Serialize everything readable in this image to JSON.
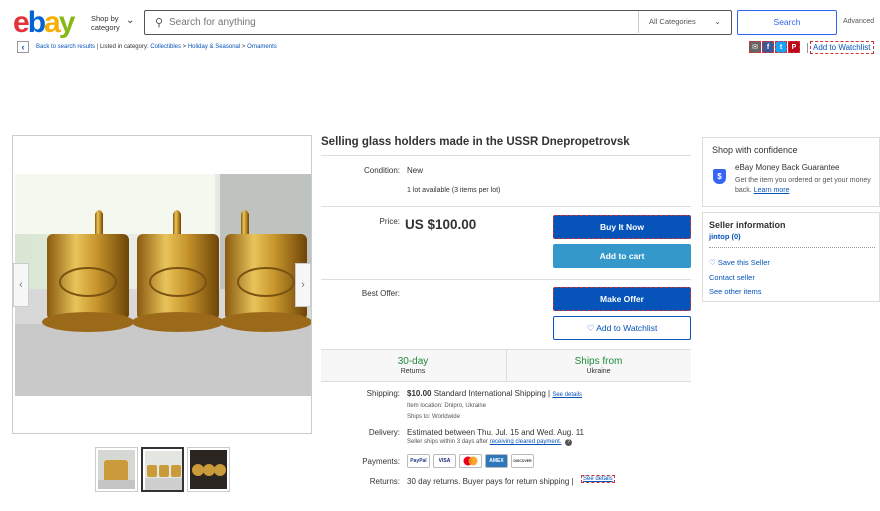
{
  "header": {
    "logo": {
      "e": "e",
      "b": "b",
      "a": "a",
      "y": "y"
    },
    "shop_by_category": "Shop by category",
    "search_placeholder": "Search for anything",
    "category_select": "All Categories",
    "search_button": "Search",
    "advanced": "Advanced"
  },
  "breadcrumb": {
    "back": "Back to search results",
    "listed_in": "Listed in category:",
    "items": [
      "Collectibles",
      "Holiday & Seasonal",
      "Ornaments"
    ]
  },
  "top_watchlist": "Add to Watchlist",
  "listing": {
    "title": "Selling glass holders made in the USSR Dnepropetrovsk",
    "condition_label": "Condition:",
    "condition_value": "New",
    "availability": "1 lot available (3 items per lot)",
    "price_label": "Price:",
    "price": "US $100.00",
    "buy_it_now": "Buy It Now",
    "add_to_cart": "Add to cart",
    "best_offer_label": "Best Offer:",
    "make_offer": "Make Offer",
    "add_to_watchlist": "Add to Watchlist",
    "returns_big": "30-day",
    "returns_sub": "Returns",
    "ships_from_big": "Ships from",
    "ships_from_sub": "Ukraine",
    "shipping_label": "Shipping:",
    "shipping_price": "$10.00",
    "shipping_method": "Standard International Shipping |",
    "see_details": "See details",
    "item_location": "Item location: Dnipro, Ukraine",
    "ships_to": "Ships to: Worldwide",
    "delivery_label": "Delivery:",
    "delivery_estimate": "Estimated between Thu. Jul. 15 and Wed. Aug. 11",
    "delivery_note": "Seller ships within 3 days after",
    "delivery_link": "receiving cleared payment.",
    "payments_label": "Payments:",
    "payment_methods": [
      "PayPal",
      "VISA",
      "MC",
      "AMEX",
      "DISCOVER"
    ],
    "returns_label": "Returns:",
    "returns_text": "30 day returns. Buyer pays for return shipping |",
    "returns_see_details": "See details"
  },
  "confidence": {
    "heading": "Shop with confidence",
    "guarantee": "eBay Money Back Guarantee",
    "guarantee_desc": "Get the item you ordered or get your money back.",
    "learn_more": "Learn more"
  },
  "seller": {
    "heading": "Seller information",
    "name": "jintop (0)",
    "save": "Save this Seller",
    "contact": "Contact seller",
    "other_items": "See other items"
  },
  "colors": {
    "primary_blue": "#0654ba",
    "accent_blue": "#3665f3",
    "light_blue_button": "#3498ca",
    "green_text": "#1e8a3c"
  }
}
